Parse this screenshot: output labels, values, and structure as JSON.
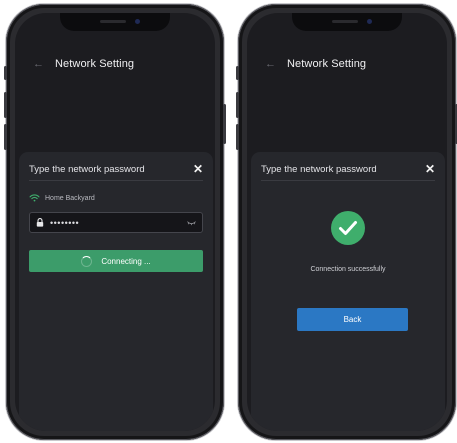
{
  "screen_left": {
    "header": {
      "title": "Network Setting"
    },
    "dialog": {
      "title": "Type the network password",
      "network_name": "Home Backyard",
      "password_value": "••••••••",
      "connect_label": "Connecting ..."
    }
  },
  "screen_right": {
    "header": {
      "title": "Network Setting"
    },
    "dialog": {
      "title": "Type the network password",
      "status_message": "Connection successfully",
      "back_label": "Back"
    }
  },
  "colors": {
    "screen_bg": "#1c1c20",
    "sheet_bg": "#26272c",
    "success_green": "#3fae6c",
    "connect_green": "#3c9c6a",
    "back_blue": "#2b78c4"
  },
  "icons": [
    "back-arrow-icon",
    "close-icon",
    "wifi-icon",
    "lock-icon",
    "eye-icon",
    "spinner-icon",
    "check-circle-icon"
  ]
}
